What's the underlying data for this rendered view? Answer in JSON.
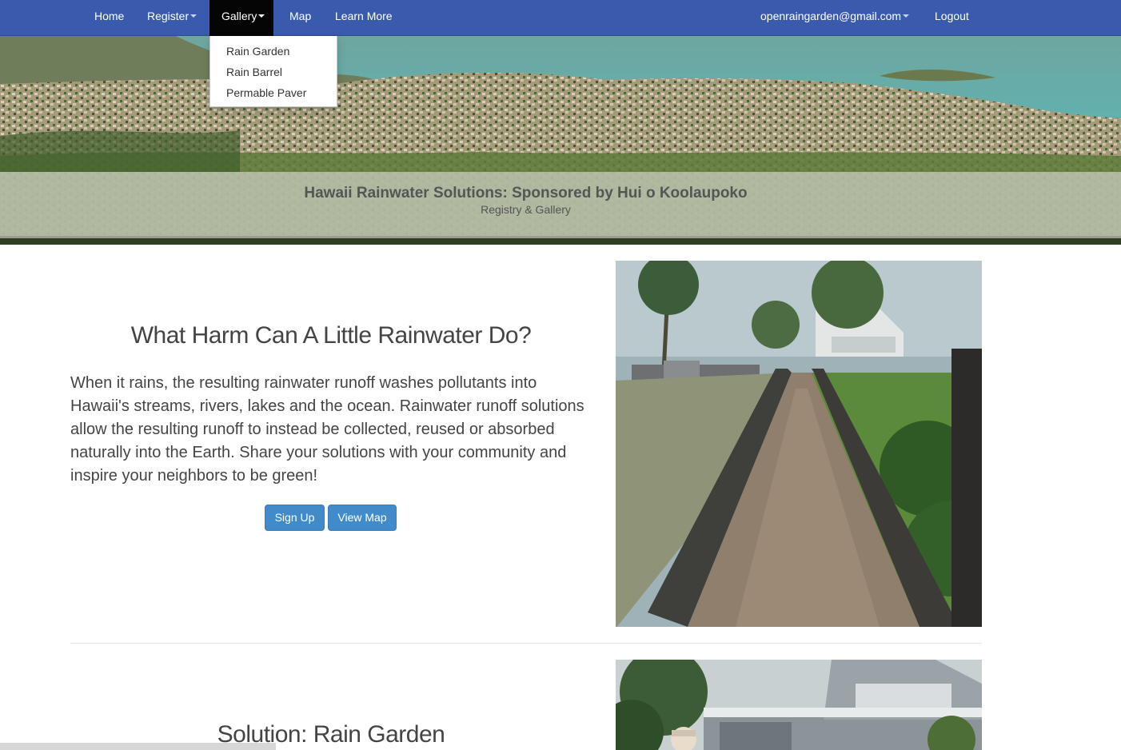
{
  "nav": {
    "items": [
      {
        "label": "Home"
      },
      {
        "label": "Register"
      },
      {
        "label": "Gallery"
      },
      {
        "label": "Map"
      },
      {
        "label": "Learn More"
      }
    ],
    "user_email": "openraingarden@gmail.com",
    "logout": "Logout",
    "gallery_dropdown": [
      "Rain Garden",
      "Rain Barrel",
      "Permable Paver"
    ]
  },
  "hero": {
    "title": "Hawaii Rainwater Solutions: Sponsored by Hui o Koolaupoko",
    "subtitle": "Registry & Gallery"
  },
  "intro": {
    "heading": "What Harm Can A Little Rainwater Do?",
    "body": "When it rains, the resulting rainwater runoff washes pollutants into Hawaii's streams, rivers, lakes and the ocean. Rainwater runoff solutions allow the resulting runoff to instead be collected, reused or absorbed naturally into the Earth. Share your solutions with your community and inspire your neighbors to be green!",
    "signup": "Sign Up",
    "view_map": "View Map"
  },
  "solution": {
    "heading": "Solution: Rain Garden"
  },
  "colors": {
    "navbar": "#3a5bad",
    "active_nav": "#050505",
    "button": "#428bca"
  }
}
